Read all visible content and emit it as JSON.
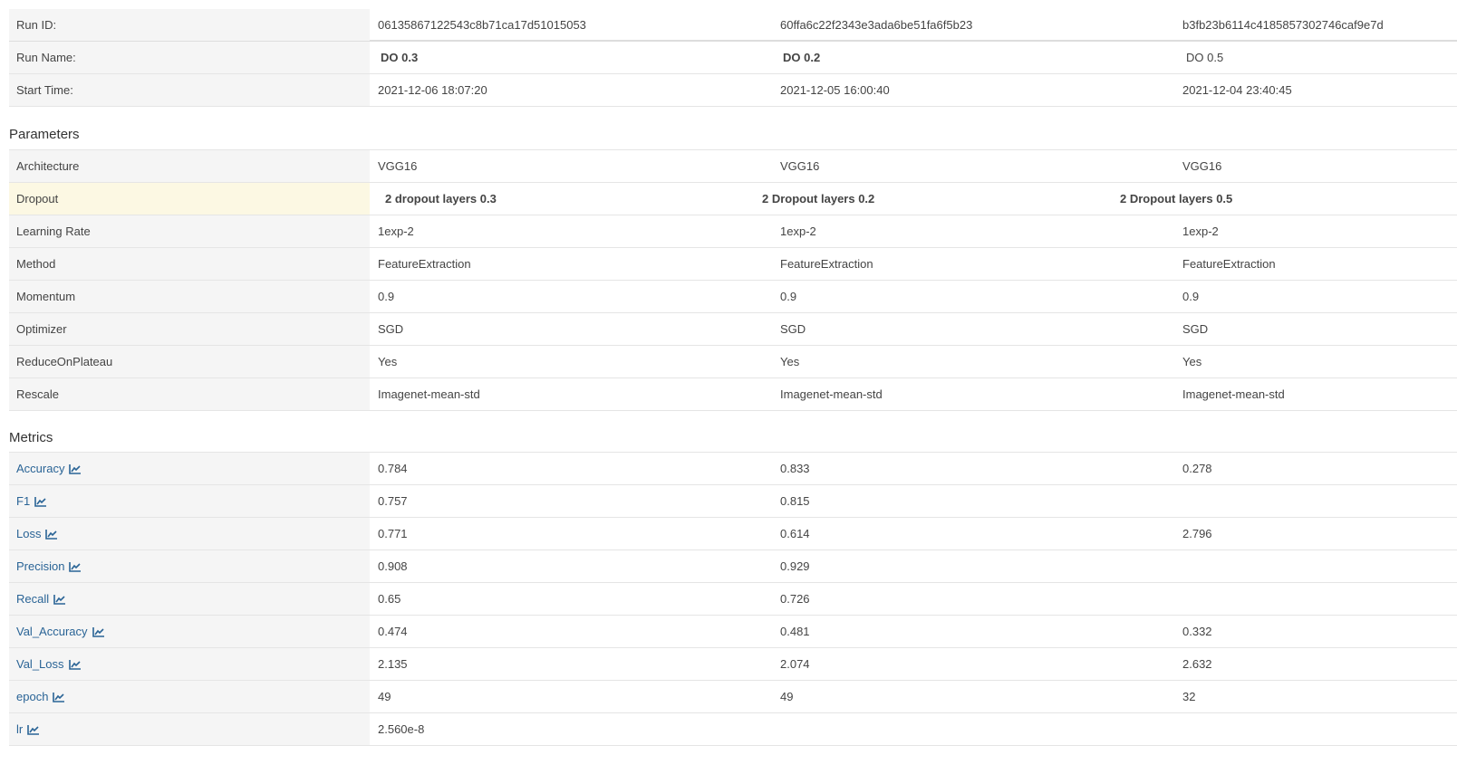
{
  "runs": {
    "labels": {
      "run_id": "Run ID:",
      "run_name": "Run Name:",
      "start_time": "Start Time:"
    },
    "ids": [
      "06135867122543c8b71ca17d51015053",
      "60ffa6c22f2343e3ada6be51fa6f5b23",
      "b3fb23b6114c4185857302746caf9e7d"
    ],
    "names": [
      "DO 0.3",
      "DO 0.2",
      "DO 0.5"
    ],
    "start_times": [
      "2021-12-06 18:07:20",
      "2021-12-05 16:00:40",
      "2021-12-04 23:40:45"
    ]
  },
  "parameters": {
    "title": "Parameters",
    "rows": [
      {
        "label": "Architecture",
        "values": [
          "VGG16",
          "VGG16",
          "VGG16"
        ]
      },
      {
        "label": "Dropout",
        "values": [
          "2 dropout layers 0.3",
          "2 Dropout layers 0.2",
          "2 Dropout layers 0.5"
        ]
      },
      {
        "label": "Learning Rate",
        "values": [
          "1exp-2",
          "1exp-2",
          "1exp-2"
        ]
      },
      {
        "label": "Method",
        "values": [
          "FeatureExtraction",
          "FeatureExtraction",
          "FeatureExtraction"
        ]
      },
      {
        "label": "Momentum",
        "values": [
          "0.9",
          "0.9",
          "0.9"
        ]
      },
      {
        "label": "Optimizer",
        "values": [
          "SGD",
          "SGD",
          "SGD"
        ]
      },
      {
        "label": "ReduceOnPlateau",
        "values": [
          "Yes",
          "Yes",
          "Yes"
        ]
      },
      {
        "label": "Rescale",
        "values": [
          "Imagenet-mean-std",
          "Imagenet-mean-std",
          "Imagenet-mean-std"
        ]
      }
    ]
  },
  "metrics": {
    "title": "Metrics",
    "rows": [
      {
        "label": "Accuracy",
        "values": [
          "0.784",
          "0.833",
          "0.278"
        ]
      },
      {
        "label": "F1",
        "values": [
          "0.757",
          "0.815",
          ""
        ]
      },
      {
        "label": "Loss",
        "values": [
          "0.771",
          "0.614",
          "2.796"
        ]
      },
      {
        "label": "Precision",
        "values": [
          "0.908",
          "0.929",
          ""
        ]
      },
      {
        "label": "Recall",
        "values": [
          "0.65",
          "0.726",
          ""
        ]
      },
      {
        "label": "Val_Accuracy",
        "values": [
          "0.474",
          "0.481",
          "0.332"
        ]
      },
      {
        "label": "Val_Loss",
        "values": [
          "2.135",
          "2.074",
          "2.632"
        ]
      },
      {
        "label": "epoch",
        "values": [
          "49",
          "49",
          "32"
        ]
      },
      {
        "label": "lr",
        "values": [
          "2.560e-8",
          "",
          ""
        ]
      }
    ]
  },
  "colors": {
    "link": "#2a6496",
    "label_bg": "#f5f5f5",
    "highlight_bg": "#fcf8e3"
  }
}
